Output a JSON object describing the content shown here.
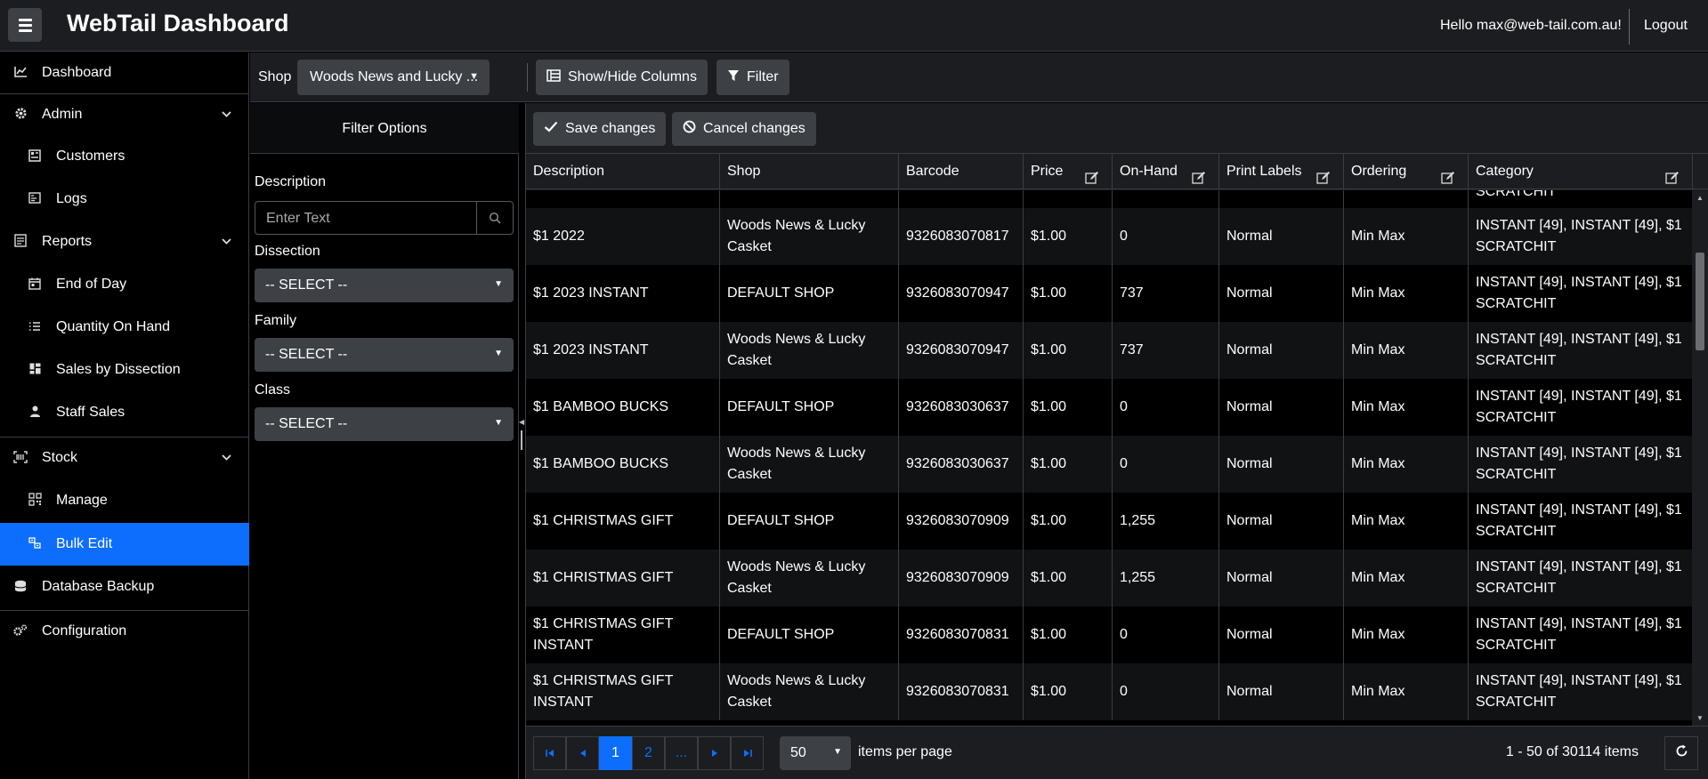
{
  "header": {
    "title": "WebTail Dashboard",
    "greeting": "Hello max@web-tail.com.au!",
    "logout": "Logout"
  },
  "sidebar": {
    "items": [
      {
        "label": "Dashboard",
        "icon": "chart-icon"
      },
      {
        "label": "Admin",
        "icon": "gear-icon"
      },
      {
        "label": "Customers",
        "icon": "customers-icon"
      },
      {
        "label": "Logs",
        "icon": "logs-icon"
      },
      {
        "label": "Reports",
        "icon": "reports-icon"
      },
      {
        "label": "End of Day",
        "icon": "calendar-icon"
      },
      {
        "label": "Quantity On Hand",
        "icon": "list-icon"
      },
      {
        "label": "Sales by Dissection",
        "icon": "grid-icon"
      },
      {
        "label": "Staff Sales",
        "icon": "user-icon"
      },
      {
        "label": "Stock",
        "icon": "barcode-icon"
      },
      {
        "label": "Manage",
        "icon": "qr-icon"
      },
      {
        "label": "Bulk Edit",
        "icon": "bulk-edit-icon"
      },
      {
        "label": "Database Backup",
        "icon": "database-icon"
      },
      {
        "label": "Configuration",
        "icon": "cogs-icon"
      }
    ],
    "active_color": "#0d6efd"
  },
  "toolbar": {
    "shop_label": "Shop",
    "shop_value": "Woods News and Lucky ...",
    "show_hide_label": "Show/Hide Columns",
    "filter_label": "Filter"
  },
  "filter_panel": {
    "title": "Filter Options",
    "description_label": "Description",
    "description_placeholder": "Enter Text",
    "dissection_label": "Dissection",
    "family_label": "Family",
    "class_label": "Class",
    "select_default": "-- SELECT --"
  },
  "grid": {
    "save_label": "Save changes",
    "cancel_label": "Cancel changes",
    "columns": [
      "Description",
      "Shop",
      "Barcode",
      "Price",
      "On-Hand",
      "Print Labels",
      "Ordering",
      "Category"
    ],
    "partial_top": "SCRATCHIT",
    "rows": [
      {
        "description": "$1 2022",
        "shop": "Woods News & Lucky Casket",
        "barcode": "9326083070817",
        "price": "$1.00",
        "onhand": "0",
        "labels": "Normal",
        "ordering": "Min Max",
        "category": "INSTANT [49], INSTANT [49], $1 SCRATCHIT"
      },
      {
        "description": "$1 2023 INSTANT",
        "shop": "DEFAULT SHOP",
        "barcode": "9326083070947",
        "price": "$1.00",
        "onhand": "737",
        "labels": "Normal",
        "ordering": "Min Max",
        "category": "INSTANT [49], INSTANT [49], $1 SCRATCHIT"
      },
      {
        "description": "$1 2023 INSTANT",
        "shop": "Woods News & Lucky Casket",
        "barcode": "9326083070947",
        "price": "$1.00",
        "onhand": "737",
        "labels": "Normal",
        "ordering": "Min Max",
        "category": "INSTANT [49], INSTANT [49], $1 SCRATCHIT"
      },
      {
        "description": "$1 BAMBOO BUCKS",
        "shop": "DEFAULT SHOP",
        "barcode": "9326083030637",
        "price": "$1.00",
        "onhand": "0",
        "labels": "Normal",
        "ordering": "Min Max",
        "category": "INSTANT [49], INSTANT [49], $1 SCRATCHIT"
      },
      {
        "description": "$1 BAMBOO BUCKS",
        "shop": "Woods News & Lucky Casket",
        "barcode": "9326083030637",
        "price": "$1.00",
        "onhand": "0",
        "labels": "Normal",
        "ordering": "Min Max",
        "category": "INSTANT [49], INSTANT [49], $1 SCRATCHIT"
      },
      {
        "description": "$1 CHRISTMAS GIFT",
        "shop": "DEFAULT SHOP",
        "barcode": "9326083070909",
        "price": "$1.00",
        "onhand": "1,255",
        "labels": "Normal",
        "ordering": "Min Max",
        "category": "INSTANT [49], INSTANT [49], $1 SCRATCHIT"
      },
      {
        "description": "$1 CHRISTMAS GIFT",
        "shop": "Woods News & Lucky Casket",
        "barcode": "9326083070909",
        "price": "$1.00",
        "onhand": "1,255",
        "labels": "Normal",
        "ordering": "Min Max",
        "category": "INSTANT [49], INSTANT [49], $1 SCRATCHIT"
      },
      {
        "description": "$1 CHRISTMAS GIFT INSTANT",
        "shop": "DEFAULT SHOP",
        "barcode": "9326083070831",
        "price": "$1.00",
        "onhand": "0",
        "labels": "Normal",
        "ordering": "Min Max",
        "category": "INSTANT [49], INSTANT [49], $1 SCRATCHIT"
      },
      {
        "description": "$1 CHRISTMAS GIFT INSTANT",
        "shop": "Woods News & Lucky Casket",
        "barcode": "9326083070831",
        "price": "$1.00",
        "onhand": "0",
        "labels": "Normal",
        "ordering": "Min Max",
        "category": "INSTANT [49], INSTANT [49], $1 SCRATCHIT"
      }
    ]
  },
  "pager": {
    "pages": [
      "1",
      "2",
      "..."
    ],
    "page_size": "50",
    "items_per_page_label": "items per page",
    "info": "1 - 50 of 30114 items"
  }
}
